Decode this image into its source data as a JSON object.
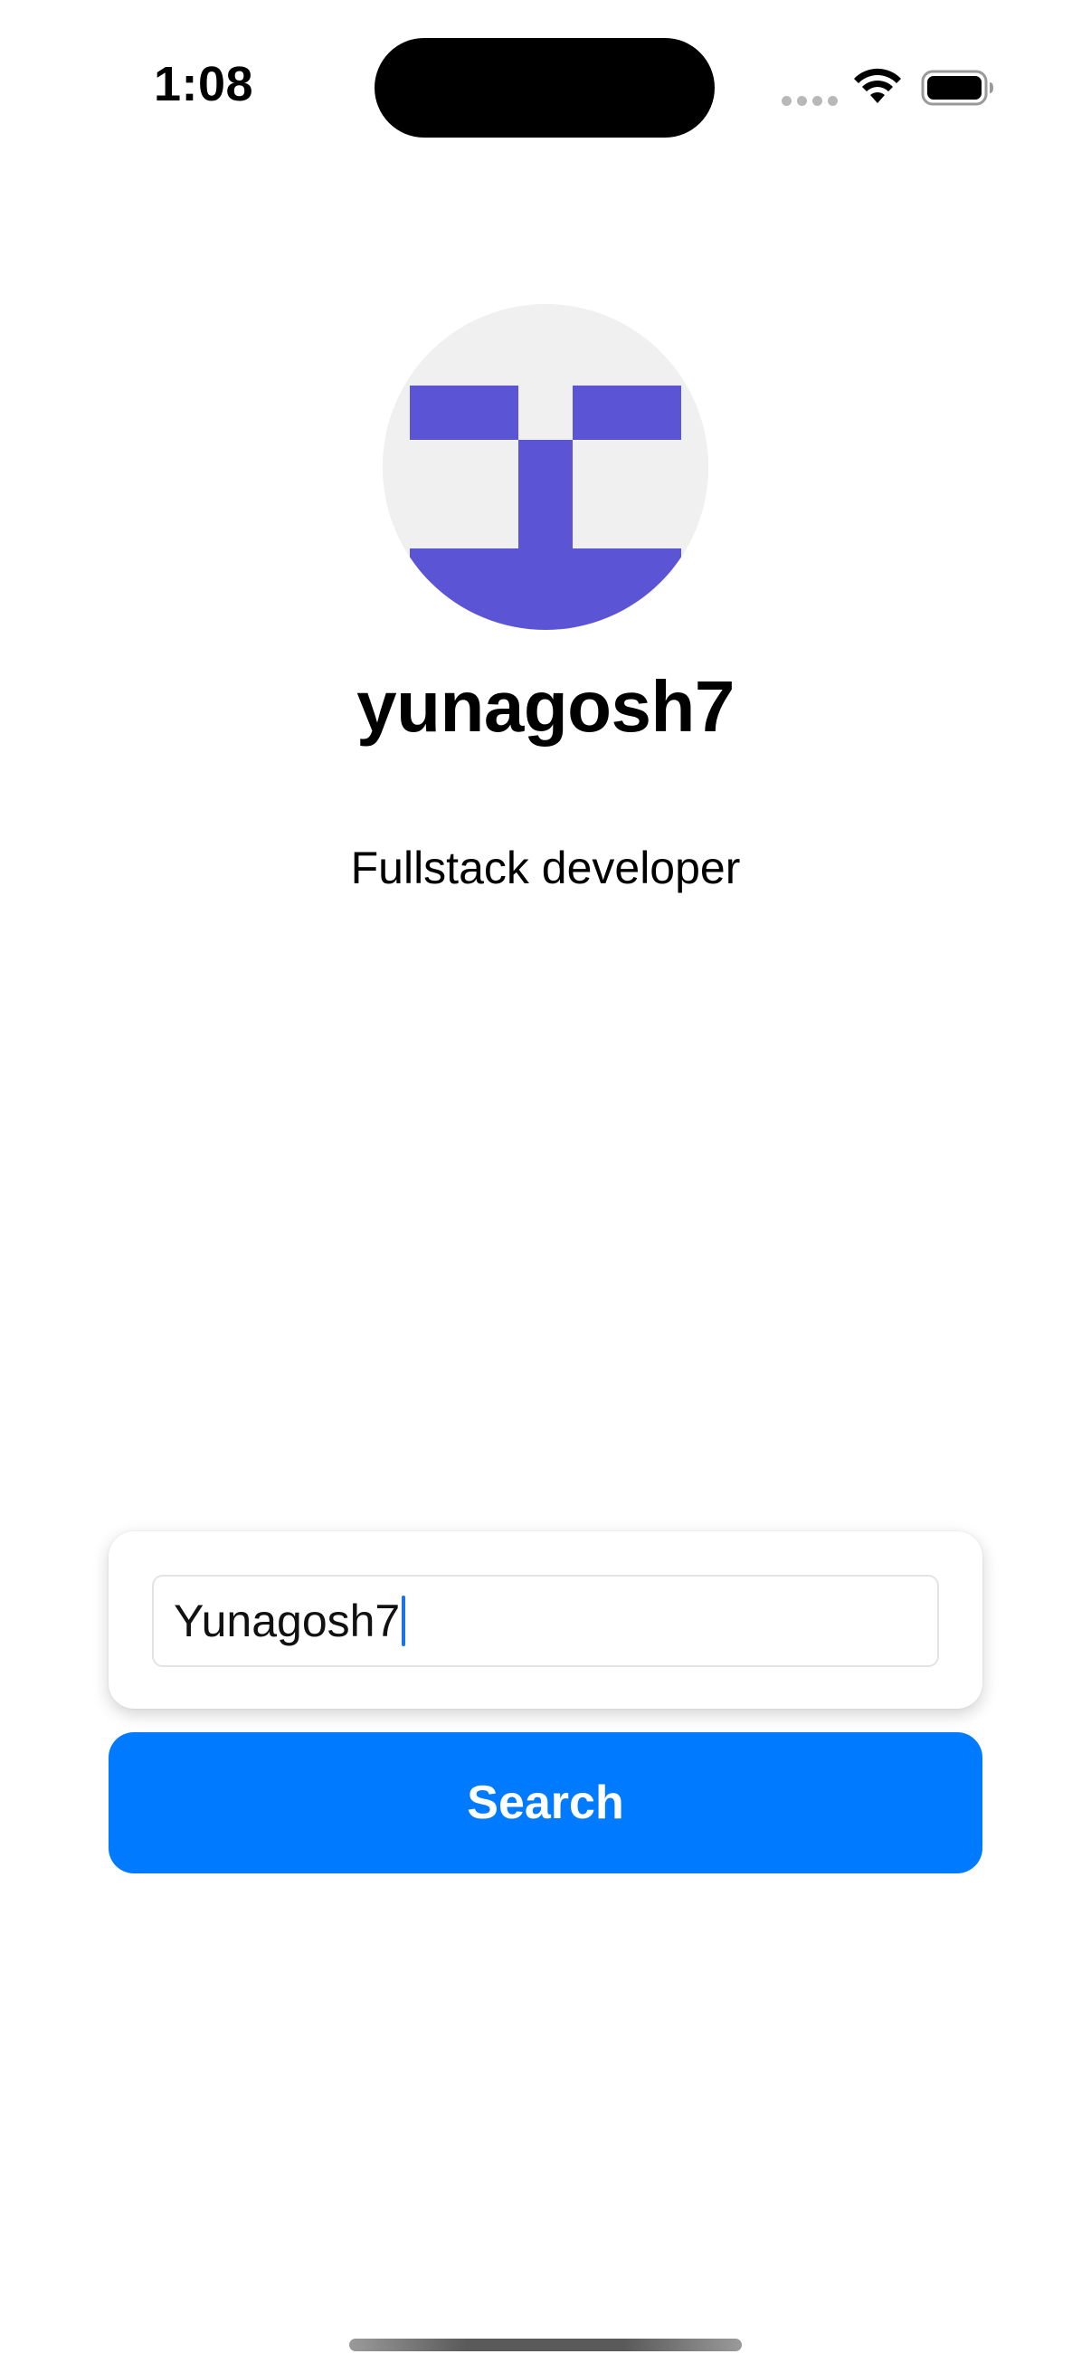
{
  "status_bar": {
    "time": "1:08",
    "icons": [
      "signal-dots-icon",
      "wifi-icon",
      "battery-icon"
    ]
  },
  "profile": {
    "avatar_icon": "identicon-avatar",
    "avatar_color": "#5b55d6",
    "avatar_background": "#f0f0f0",
    "username": "yunagosh7",
    "bio": "Fullstack developer"
  },
  "search": {
    "input_value": "Yunagosh7",
    "button_label": "Search",
    "button_color": "#007aff"
  }
}
